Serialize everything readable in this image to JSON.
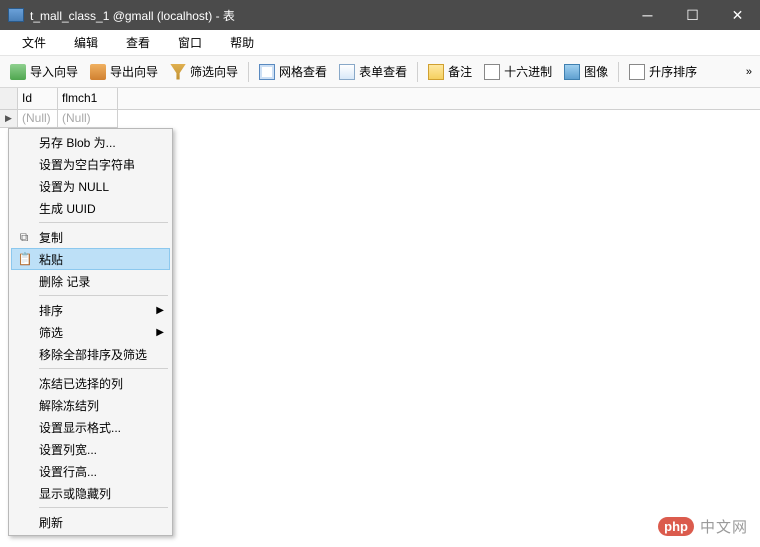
{
  "window": {
    "title": "t_mall_class_1 @gmall (localhost) - 表"
  },
  "menubar": {
    "file": "文件",
    "edit": "编辑",
    "view": "查看",
    "window": "窗口",
    "help": "帮助"
  },
  "toolbar": {
    "import_wizard": "导入向导",
    "export_wizard": "导出向导",
    "filter_wizard": "筛选向导",
    "grid_view": "网格查看",
    "form_view": "表单查看",
    "notes": "备注",
    "hex": "十六进制",
    "image": "图像",
    "sort_asc": "升序排序"
  },
  "grid": {
    "columns": [
      "Id",
      "flmch1"
    ],
    "rows": [
      {
        "id": "(Null)",
        "flmch1": "(Null)",
        "selected": true
      }
    ]
  },
  "context_menu": {
    "save_blob_as": "另存 Blob 为...",
    "set_empty_string": "设置为空白字符串",
    "set_null": "设置为 NULL",
    "gen_uuid": "生成 UUID",
    "copy": "复制",
    "paste": "粘贴",
    "delete_record": "删除 记录",
    "sort": "排序",
    "filter": "筛选",
    "remove_all_sort_filter": "移除全部排序及筛选",
    "freeze_selected_cols": "冻结已选择的列",
    "unfreeze_cols": "解除冻结列",
    "set_display_format": "设置显示格式...",
    "set_col_width": "设置列宽...",
    "set_row_height": "设置行高...",
    "show_hide_cols": "显示或隐藏列",
    "refresh": "刷新"
  },
  "watermark": {
    "badge": "php",
    "text": "中文网"
  }
}
